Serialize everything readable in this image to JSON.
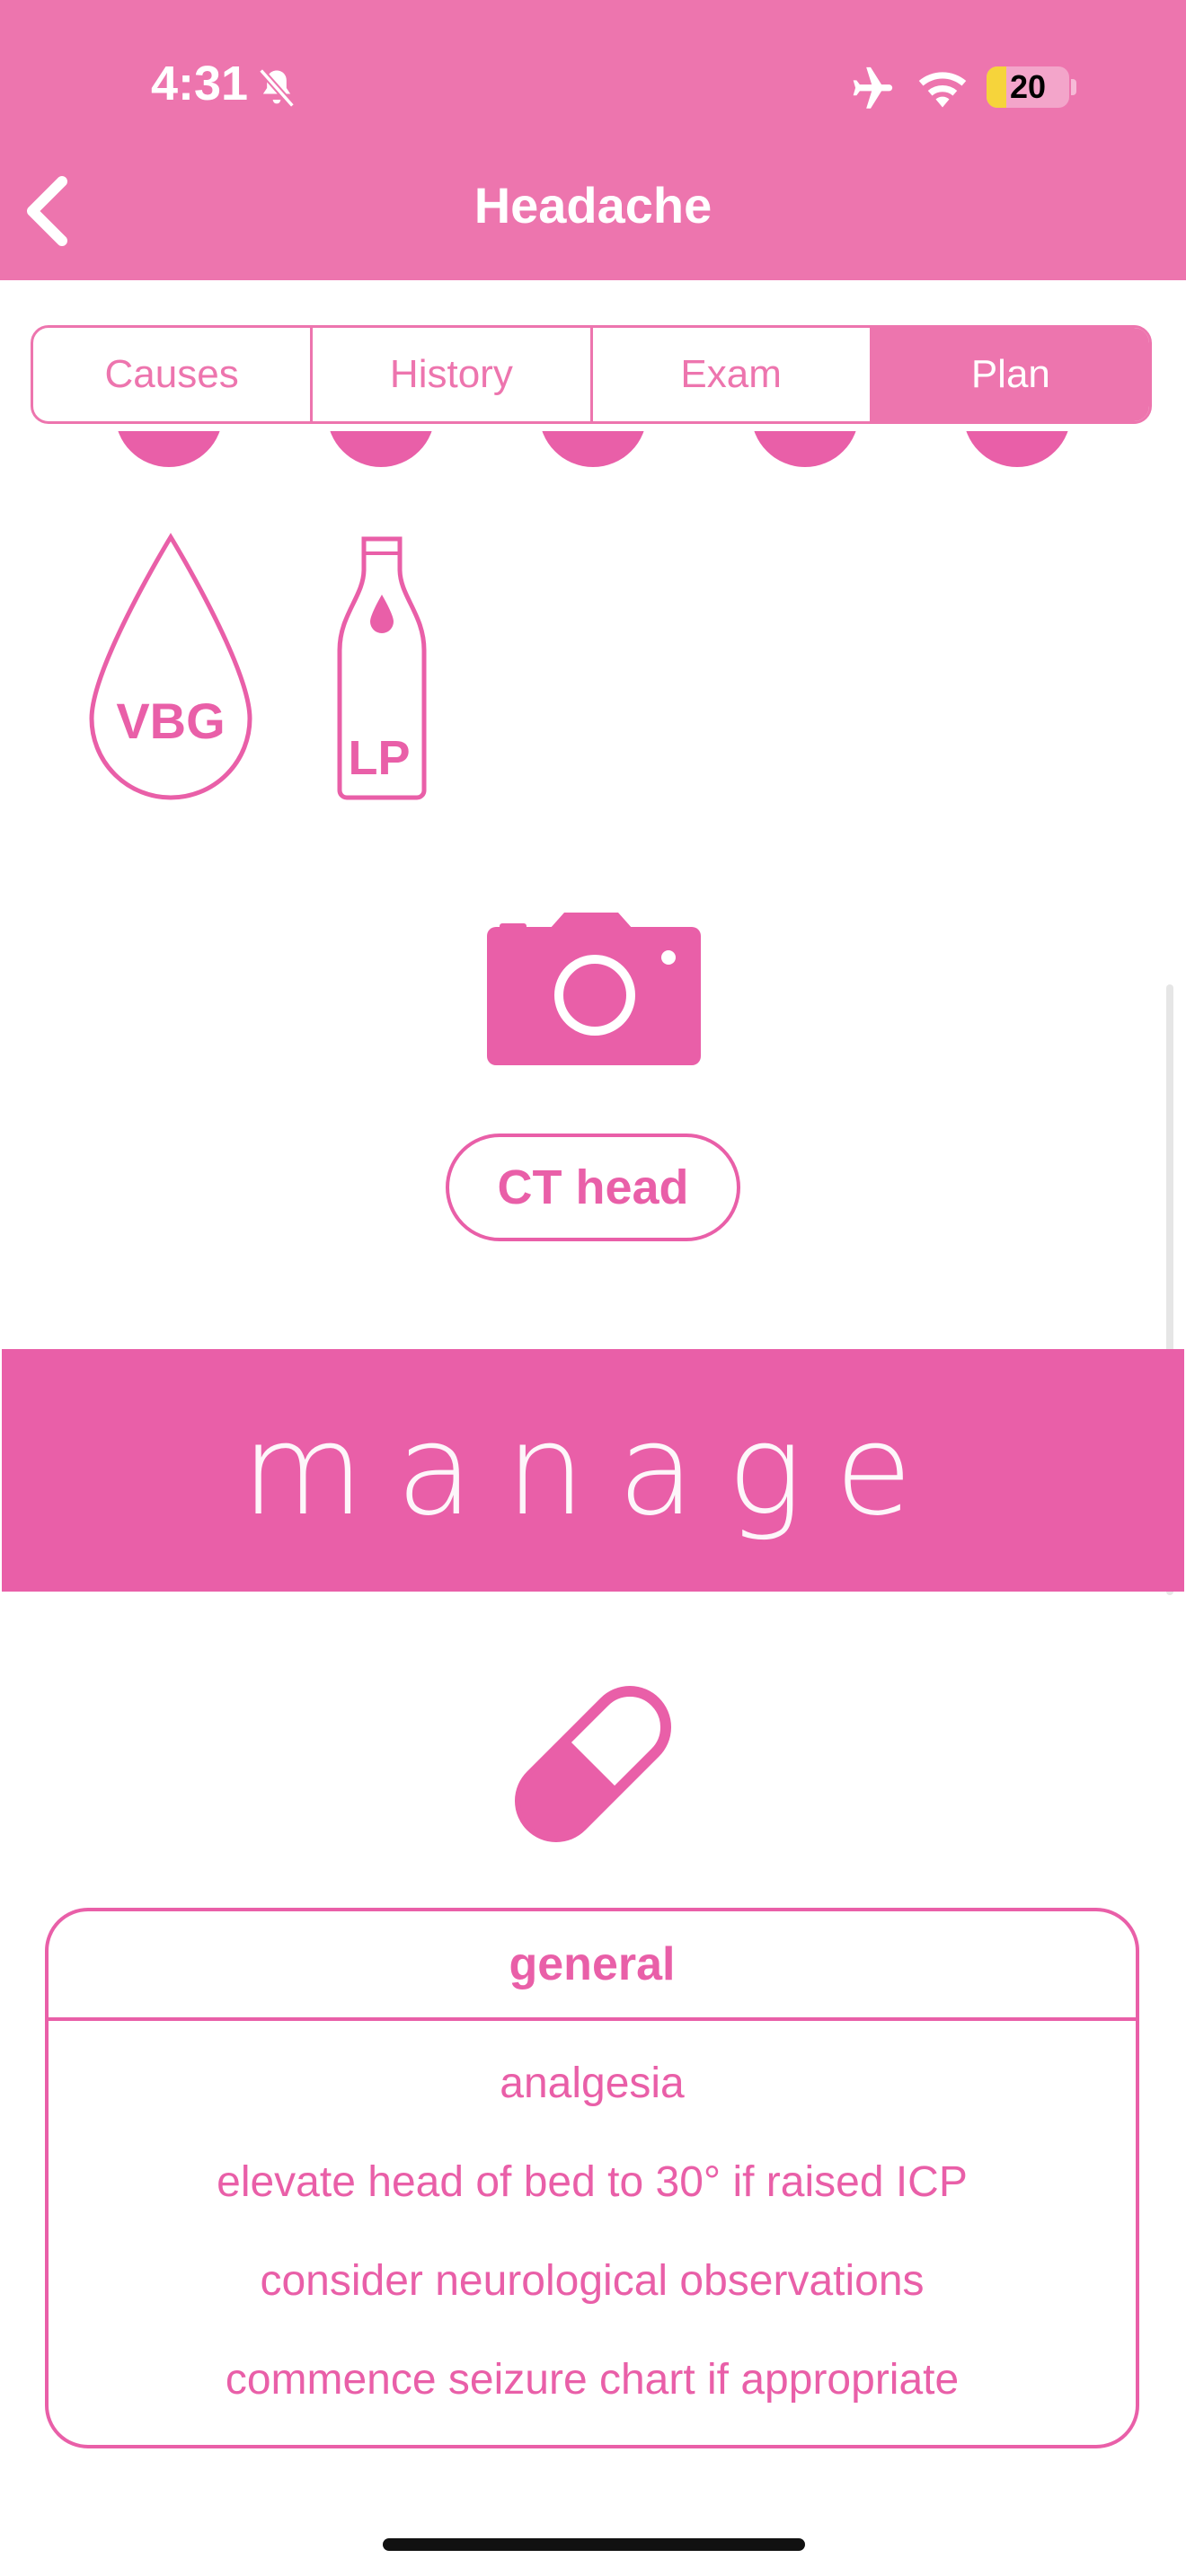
{
  "status_bar": {
    "time": "4:31",
    "battery_level": "20"
  },
  "header": {
    "title": "Headache"
  },
  "tabs": [
    {
      "label": "Causes"
    },
    {
      "label": "History"
    },
    {
      "label": "Exam"
    },
    {
      "label": "Plan",
      "active": true
    }
  ],
  "investigations": {
    "vbg_label": "VBG",
    "lp_label": "LP",
    "ct_label": "CT head"
  },
  "manage_banner": {
    "title": "manage"
  },
  "general_card": {
    "title": "general",
    "items": [
      "analgesia",
      "elevate head of bed to 30° if raised ICP",
      "consider neurological observations",
      "commence seizure chart if appropriate"
    ]
  },
  "colors": {
    "header": "#ed75ae",
    "accent": "#e95fa8",
    "text_on_accent": "#ffffff"
  }
}
